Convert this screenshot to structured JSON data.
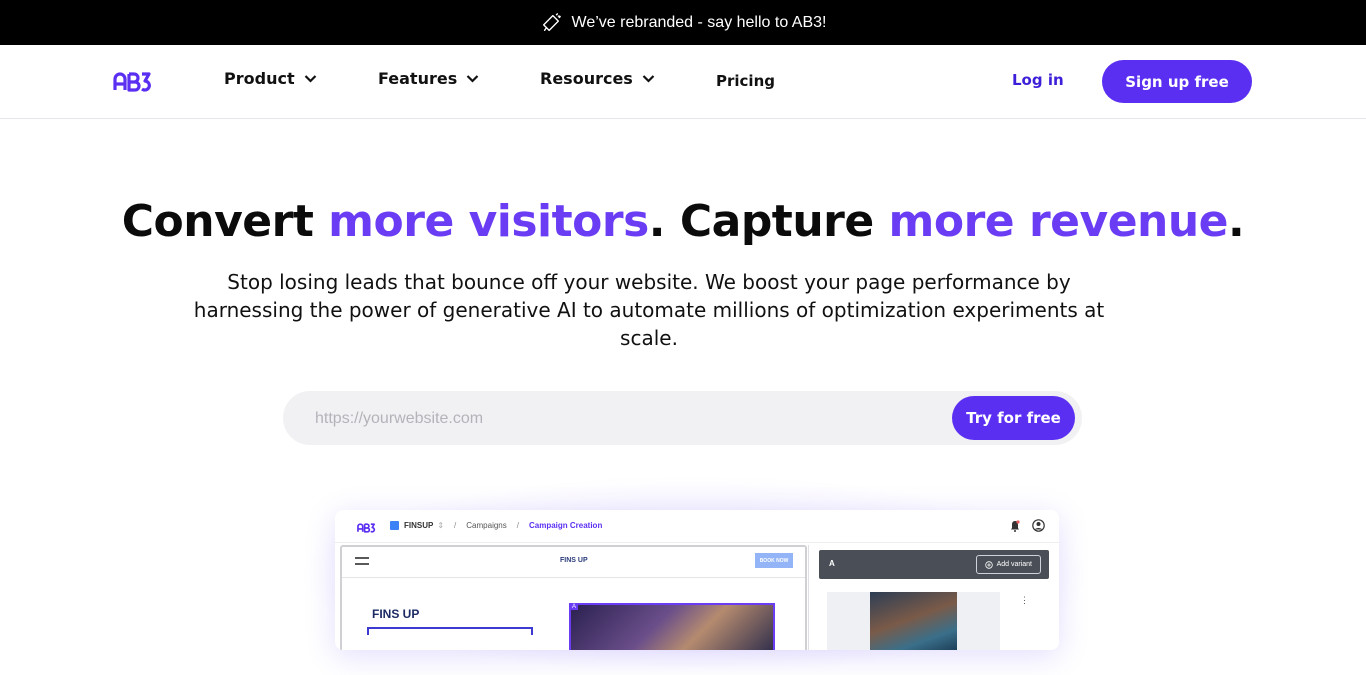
{
  "banner": {
    "icon": "megaphone-icon",
    "text": "We’ve rebranded - say hello to AB3!"
  },
  "nav": {
    "logo_text": "AB3",
    "items": [
      {
        "label": "Product",
        "has_dropdown": true
      },
      {
        "label": "Features",
        "has_dropdown": true
      },
      {
        "label": "Resources",
        "has_dropdown": true
      },
      {
        "label": "Pricing",
        "has_dropdown": false
      }
    ],
    "login_label": "Log in",
    "signup_label": "Sign up free"
  },
  "hero": {
    "headline_part1": "Convert ",
    "headline_accent1": "more visitors",
    "headline_part2": ". Capture ",
    "headline_accent2": "more revenue",
    "headline_part3": ".",
    "subtitle": "Stop losing leads that bounce off your website. We boost your page performance by harnessing the power of generative AI to automate millions of optimization experiments at scale."
  },
  "search": {
    "placeholder": "https://yourwebsite.com",
    "value": "",
    "button_label": "Try for free"
  },
  "preview": {
    "logo_text": "AB3",
    "workspace": "FINSUP",
    "crumb_campaigns": "Campaigns",
    "crumb_active": "Campaign Creation",
    "site_brand": "FINS UP",
    "book_label": "BOOK NOW",
    "hero_title": "FINS UP",
    "image_tag": "A",
    "variant_label": "A",
    "add_variant_label": "Add variant"
  },
  "colors": {
    "accent": "#6a3df5",
    "button": "#5b2ff2",
    "login": "#3d1fd9",
    "banner_bg": "#000000"
  }
}
